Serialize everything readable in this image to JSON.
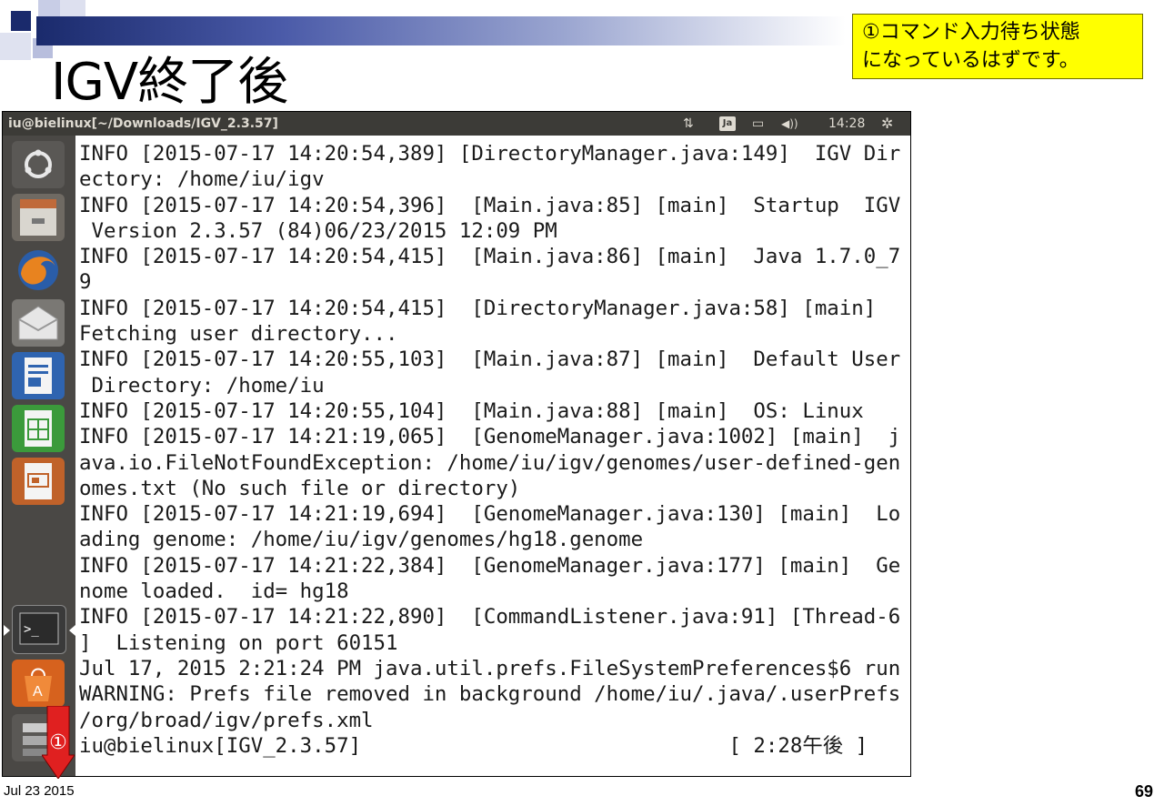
{
  "slide": {
    "title": "IGV終了後",
    "callout_line1": "①コマンド入力待ち状態",
    "callout_line2": "になっているはずです。",
    "footer_date": "Jul 23 2015",
    "page_number": "69",
    "marker_label": "①"
  },
  "window": {
    "title": "iu@bielinux[~/Downloads/IGV_2.3.57]",
    "indicators": {
      "network": "⇅",
      "keyboard": "Ja",
      "battery": "▭",
      "volume": "◀))",
      "clock": "14:28",
      "settings": "✲"
    }
  },
  "launcher": {
    "items": [
      "dash-icon",
      "files-icon",
      "firefox-icon",
      "mail-icon",
      "writer-icon",
      "calc-icon",
      "impress-icon",
      "terminal-icon",
      "software-center-icon",
      "workspace-icon"
    ]
  },
  "terminal": {
    "lines": [
      "INFO [2015-07-17 14:20:54,389] [DirectoryManager.java:149]  IGV Dir",
      "ectory: /home/iu/igv",
      "INFO [2015-07-17 14:20:54,396]  [Main.java:85] [main]  Startup  IGV",
      " Version 2.3.57 (84)06/23/2015 12:09 PM",
      "INFO [2015-07-17 14:20:54,415]  [Main.java:86] [main]  Java 1.7.0_7",
      "9",
      "INFO [2015-07-17 14:20:54,415]  [DirectoryManager.java:58] [main]",
      "Fetching user directory...",
      "INFO [2015-07-17 14:20:55,103]  [Main.java:87] [main]  Default User",
      " Directory: /home/iu",
      "INFO [2015-07-17 14:20:55,104]  [Main.java:88] [main]  OS: Linux",
      "INFO [2015-07-17 14:21:19,065]  [GenomeManager.java:1002] [main]  j",
      "ava.io.FileNotFoundException: /home/iu/igv/genomes/user-defined-gen",
      "omes.txt (No such file or directory)",
      "INFO [2015-07-17 14:21:19,694]  [GenomeManager.java:130] [main]  Lo",
      "ading genome: /home/iu/igv/genomes/hg18.genome",
      "INFO [2015-07-17 14:21:22,384]  [GenomeManager.java:177] [main]  Ge",
      "nome loaded.  id= hg18",
      "INFO [2015-07-17 14:21:22,890]  [CommandListener.java:91] [Thread-6",
      "]  Listening on port 60151",
      "Jul 17, 2015 2:21:24 PM java.util.prefs.FileSystemPreferences$6 run",
      "WARNING: Prefs file removed in background /home/iu/.java/.userPrefs",
      "/org/broad/igv/prefs.xml",
      "iu@bielinux[IGV_2.3.57]                              [ 2:28午後 ]"
    ]
  }
}
